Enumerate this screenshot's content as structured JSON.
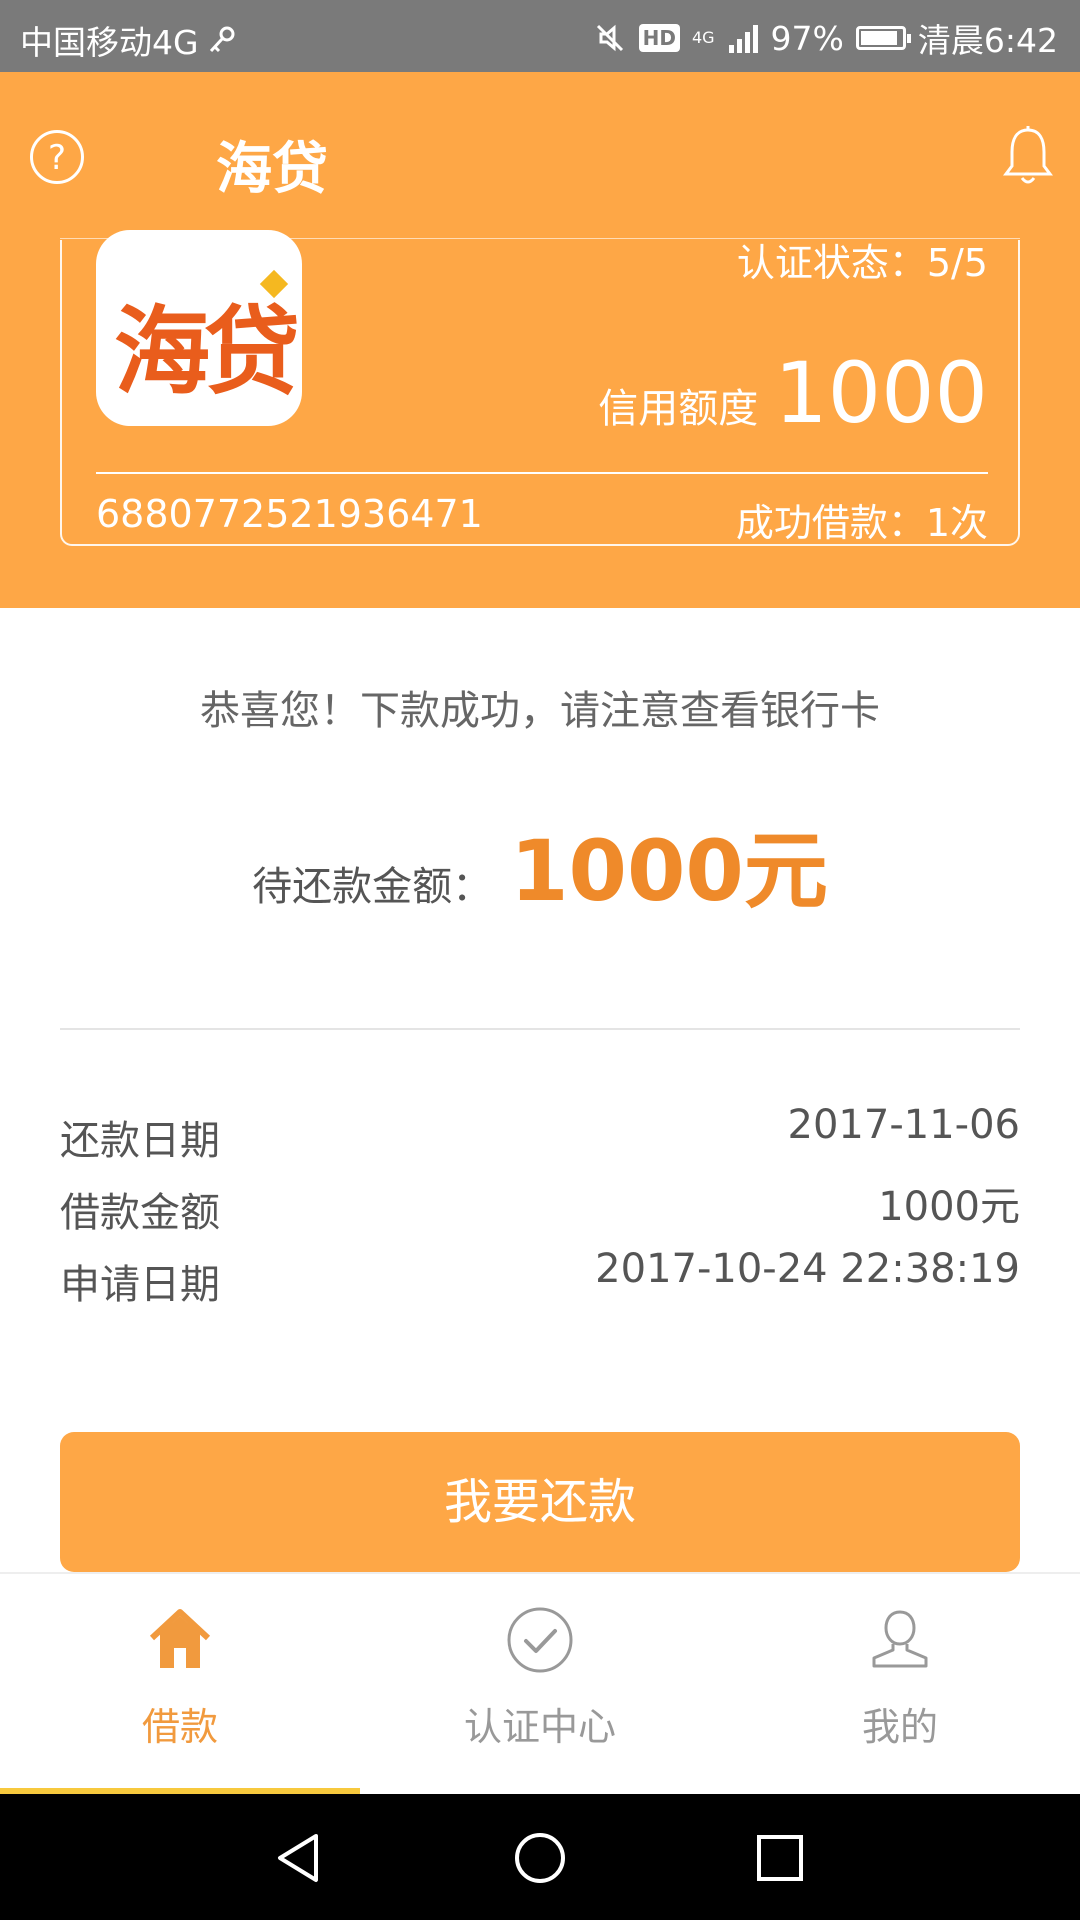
{
  "status_bar": {
    "carrier": "中国移动4G",
    "hd_badge": "HD",
    "network": "4G",
    "battery": "97%",
    "time": "清晨6:42"
  },
  "header": {
    "title": "海贷",
    "help_icon": "question-circle-icon",
    "bell_icon": "bell-icon"
  },
  "card": {
    "logo_text": "海贷",
    "auth_status": "认证状态：5/5",
    "credit_label": "信用额度",
    "credit_value": "1000",
    "card_number": "6880772521936471",
    "loan_count": "成功借款：1次"
  },
  "main": {
    "success_message": "恭喜您！下款成功，请注意查看银行卡",
    "due_label": "待还款金额：",
    "due_value": "1000元"
  },
  "details": [
    {
      "label": "还款日期",
      "value": "2017-11-06"
    },
    {
      "label": "借款金额",
      "value": "1000元"
    },
    {
      "label": "申请日期",
      "value": "2017-10-24 22:38:19"
    }
  ],
  "repay_button": "我要还款",
  "bottom_nav": {
    "items": [
      {
        "label": "借款",
        "icon": "home-icon",
        "active": true
      },
      {
        "label": "认证中心",
        "icon": "check-circle-icon",
        "active": false
      },
      {
        "label": "我的",
        "icon": "user-icon",
        "active": false
      }
    ]
  },
  "colors": {
    "brand": "#fea746",
    "accent_amount": "#ef8a2a",
    "nav_active": "#f19a3e"
  }
}
